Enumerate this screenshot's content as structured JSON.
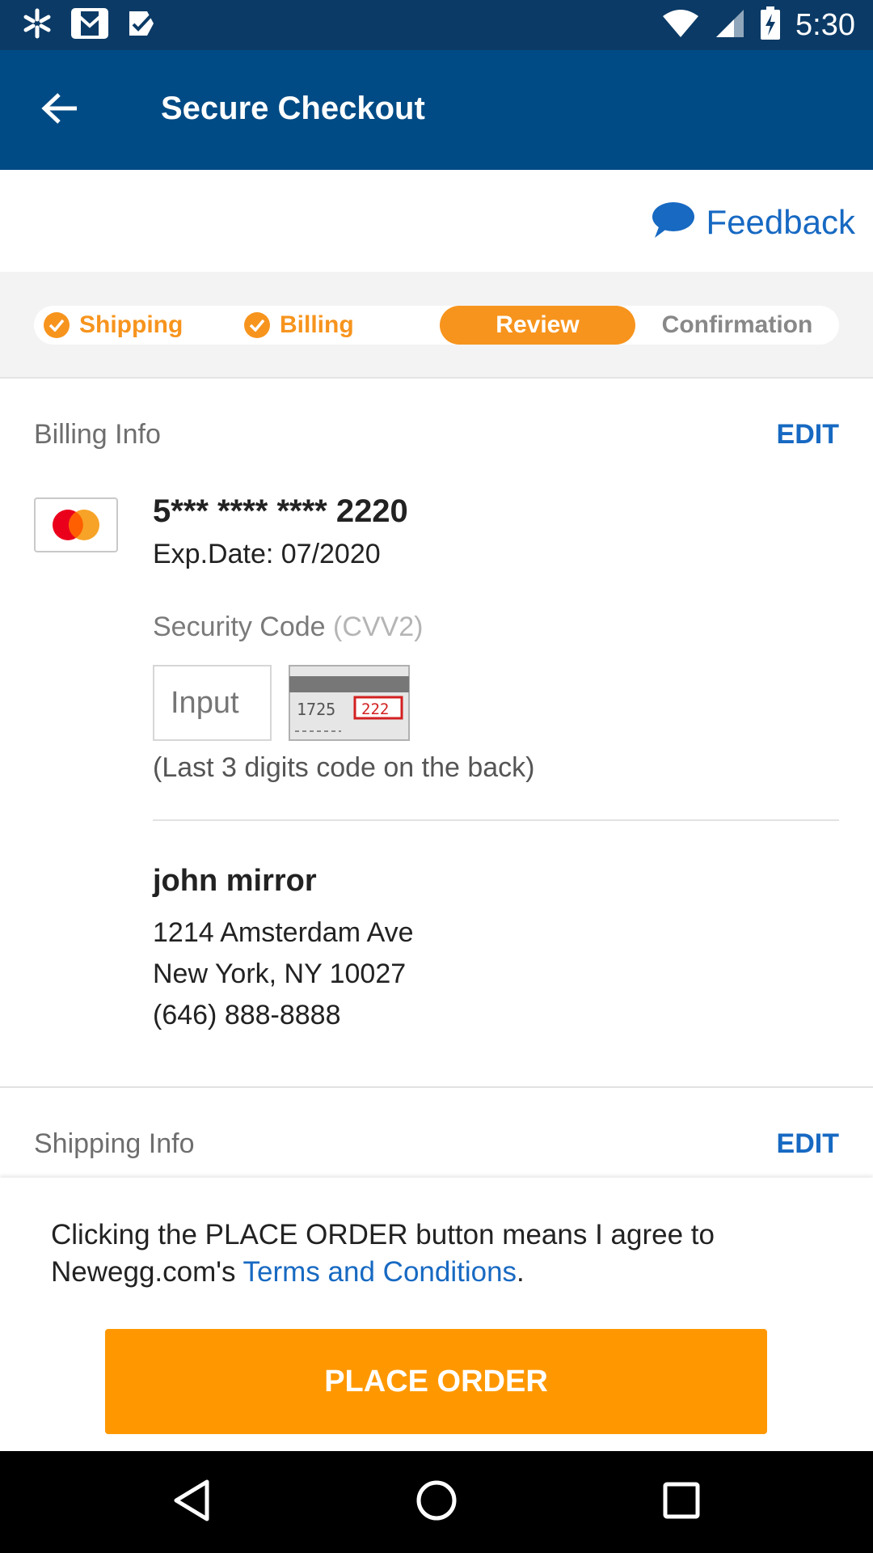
{
  "status_bar": {
    "time": "5:30",
    "left_icons": [
      "walmart-spark-icon",
      "gmail-icon",
      "tasks-check-icon"
    ],
    "right_icons": [
      "wifi-icon",
      "signal-icon",
      "battery-charging-icon"
    ]
  },
  "app_bar": {
    "title": "Secure Checkout",
    "back_icon": "arrow-back-icon"
  },
  "feedback": {
    "label": "Feedback",
    "icon": "chat-bubble-icon"
  },
  "steps": [
    {
      "label": "Shipping",
      "state": "done"
    },
    {
      "label": "Billing",
      "state": "done"
    },
    {
      "label": "Review",
      "state": "active"
    },
    {
      "label": "Confirmation",
      "state": "pending"
    }
  ],
  "billing": {
    "title": "Billing Info",
    "edit_label": "EDIT",
    "card_number": "5*** **** **** 2220",
    "exp_date": "Exp.Date: 07/2020",
    "security_label": "Security Code",
    "security_label_suffix": "(CVV2)",
    "cvv_placeholder": "Input",
    "cvv_card_digits_left": "1725",
    "cvv_card_digits_right": "222",
    "cvv_hint": "(Last 3 digits code on the back)",
    "name": "john mirror",
    "address_line1": "1214 Amsterdam Ave",
    "address_line2": "New York, NY 10027",
    "phone": "(646) 888-8888"
  },
  "shipping": {
    "title": "Shipping Info",
    "edit_label": "EDIT"
  },
  "order": {
    "terms_prefix": "Clicking the PLACE ORDER button means I agree to Newegg.com's ",
    "terms_link": "Terms and Conditions",
    "terms_suffix": ".",
    "place_order_label": "PLACE ORDER"
  },
  "colors": {
    "status_bar": "#0b3a66",
    "app_bar": "#004b85",
    "accent_orange": "#f7941d",
    "button_orange": "#ff9800",
    "link_blue": "#1769c2"
  }
}
